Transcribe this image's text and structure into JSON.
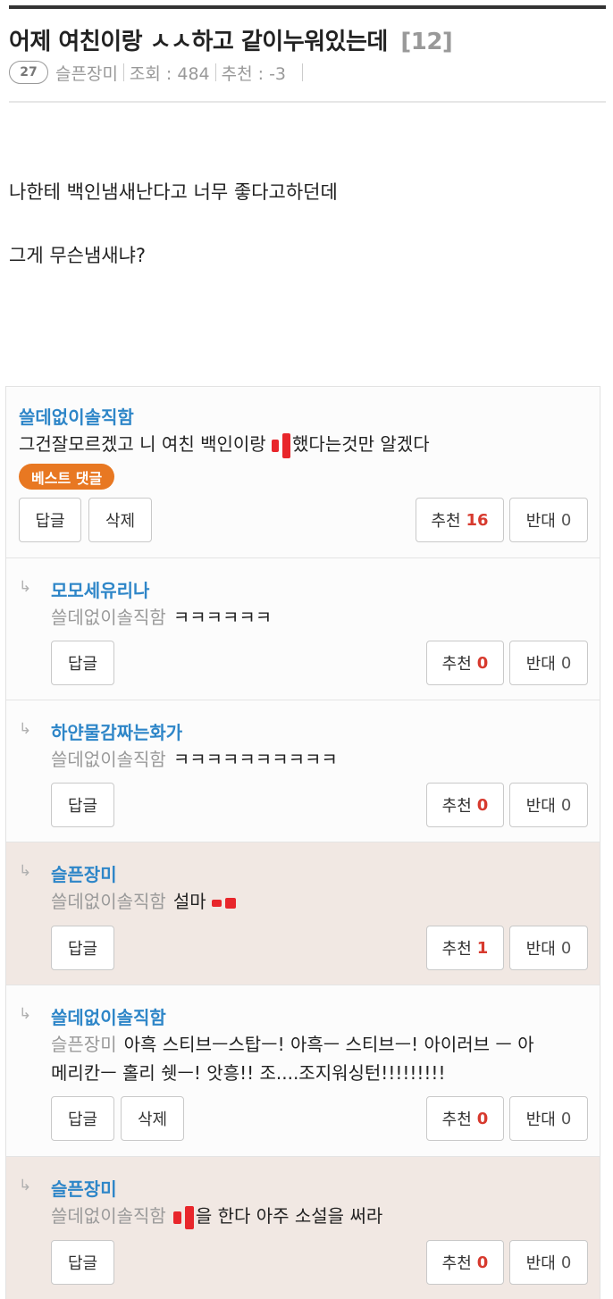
{
  "post": {
    "title": "어제 여친이랑 ㅅㅅ하고 같이누워있는데",
    "comment_count": "[12]",
    "level": "27",
    "author": "슬픈장미",
    "views": "조회 : 484",
    "votes": "추천 : -3",
    "body": [
      "나한테 백인냄새난다고 너무 좋다고하던데",
      "그게 무슨냄새냐?"
    ]
  },
  "colors": {
    "accent_blue": "#2e86c8",
    "vote_red": "#d73a2e",
    "best_badge": "#e87822",
    "highlight_bg": "#f1e8e3",
    "censor_red": "#e8262b"
  },
  "comments": [
    {
      "author": "쓸데없이솔직함",
      "text_before": "그건잘모르겠고 니 여친 백인이랑 ",
      "text_after": "했다는것만 알겠다",
      "badge": "베스트 댓글",
      "reply_label": "답글",
      "delete_label": "삭제",
      "up_label": "추천",
      "up_count": "16",
      "down_label": "반대",
      "down_count": "0"
    },
    {
      "author": "모모세유리나",
      "mention": "쓸데없이솔직함",
      "text": "ㅋㅋㅋㅋㅋㅋ",
      "reply_label": "답글",
      "up_label": "추천",
      "up_count": "0",
      "down_label": "반대",
      "down_count": "0"
    },
    {
      "author": "하얀물감짜는화가",
      "mention": "쓸데없이솔직함",
      "text": "ㅋㅋㅋㅋㅋㅋㅋㅋㅋㅋ",
      "reply_label": "답글",
      "up_label": "추천",
      "up_count": "0",
      "down_label": "반대",
      "down_count": "0"
    },
    {
      "author": "슬픈장미",
      "mention": "쓸데없이솔직함",
      "text": "설마 ",
      "reply_label": "답글",
      "up_label": "추천",
      "up_count": "1",
      "down_label": "반대",
      "down_count": "0"
    },
    {
      "author": "쓸데없이솔직함",
      "mention": "슬픈장미",
      "text_line1": "아흑 스티브ㅡ스탑ㅡ! 아흑ㅡ 스티브ㅡ! 아이러브 ㅡ 아",
      "text_line2": "메리칸ㅡ 홀리 쉣ㅡ! 앗흥!! 조....조지워싱턴!!!!!!!!!",
      "reply_label": "답글",
      "delete_label": "삭제",
      "up_label": "추천",
      "up_count": "0",
      "down_label": "반대",
      "down_count": "0"
    },
    {
      "author": "슬픈장미",
      "mention": "쓸데없이솔직함",
      "text": "을 한다 아주 소설을 써라",
      "reply_label": "답글",
      "up_label": "추천",
      "up_count": "0",
      "down_label": "반대",
      "down_count": "0"
    }
  ],
  "icons": {
    "reply_arrow": "reply-arrow-icon",
    "censor": "censor-mark"
  }
}
